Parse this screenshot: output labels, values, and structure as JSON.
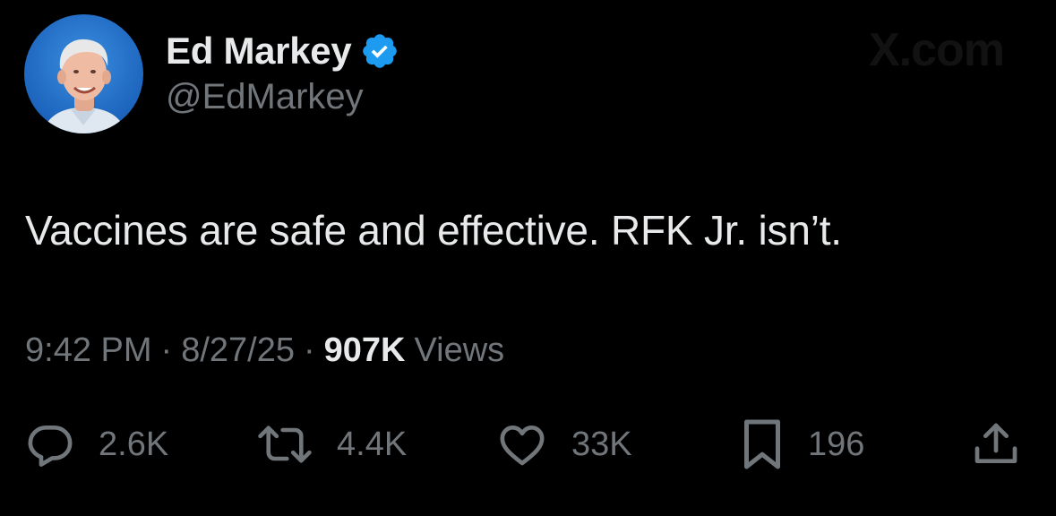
{
  "author": {
    "display_name": "Ed Markey",
    "handle": "@EdMarkey",
    "verified": true,
    "verified_color": "#1d9bf0"
  },
  "watermark": "X.com",
  "tweet": {
    "text": "Vaccines are safe and effective. RFK Jr. isn’t."
  },
  "meta": {
    "time": "9:42 PM",
    "separator": "·",
    "date": "8/27/25",
    "views_count": "907K",
    "views_label": "Views"
  },
  "actions": {
    "replies": "2.6K",
    "reposts": "4.4K",
    "likes": "33K",
    "bookmarks": "196"
  },
  "icons": {
    "reply": "reply-icon",
    "repost": "repost-icon",
    "like": "heart-icon",
    "bookmark": "bookmark-icon",
    "share": "share-icon"
  },
  "colors": {
    "background": "#000000",
    "primary_text": "#e7e9ea",
    "secondary_text": "#71767b",
    "avatar_background": "#1e6fc9"
  }
}
